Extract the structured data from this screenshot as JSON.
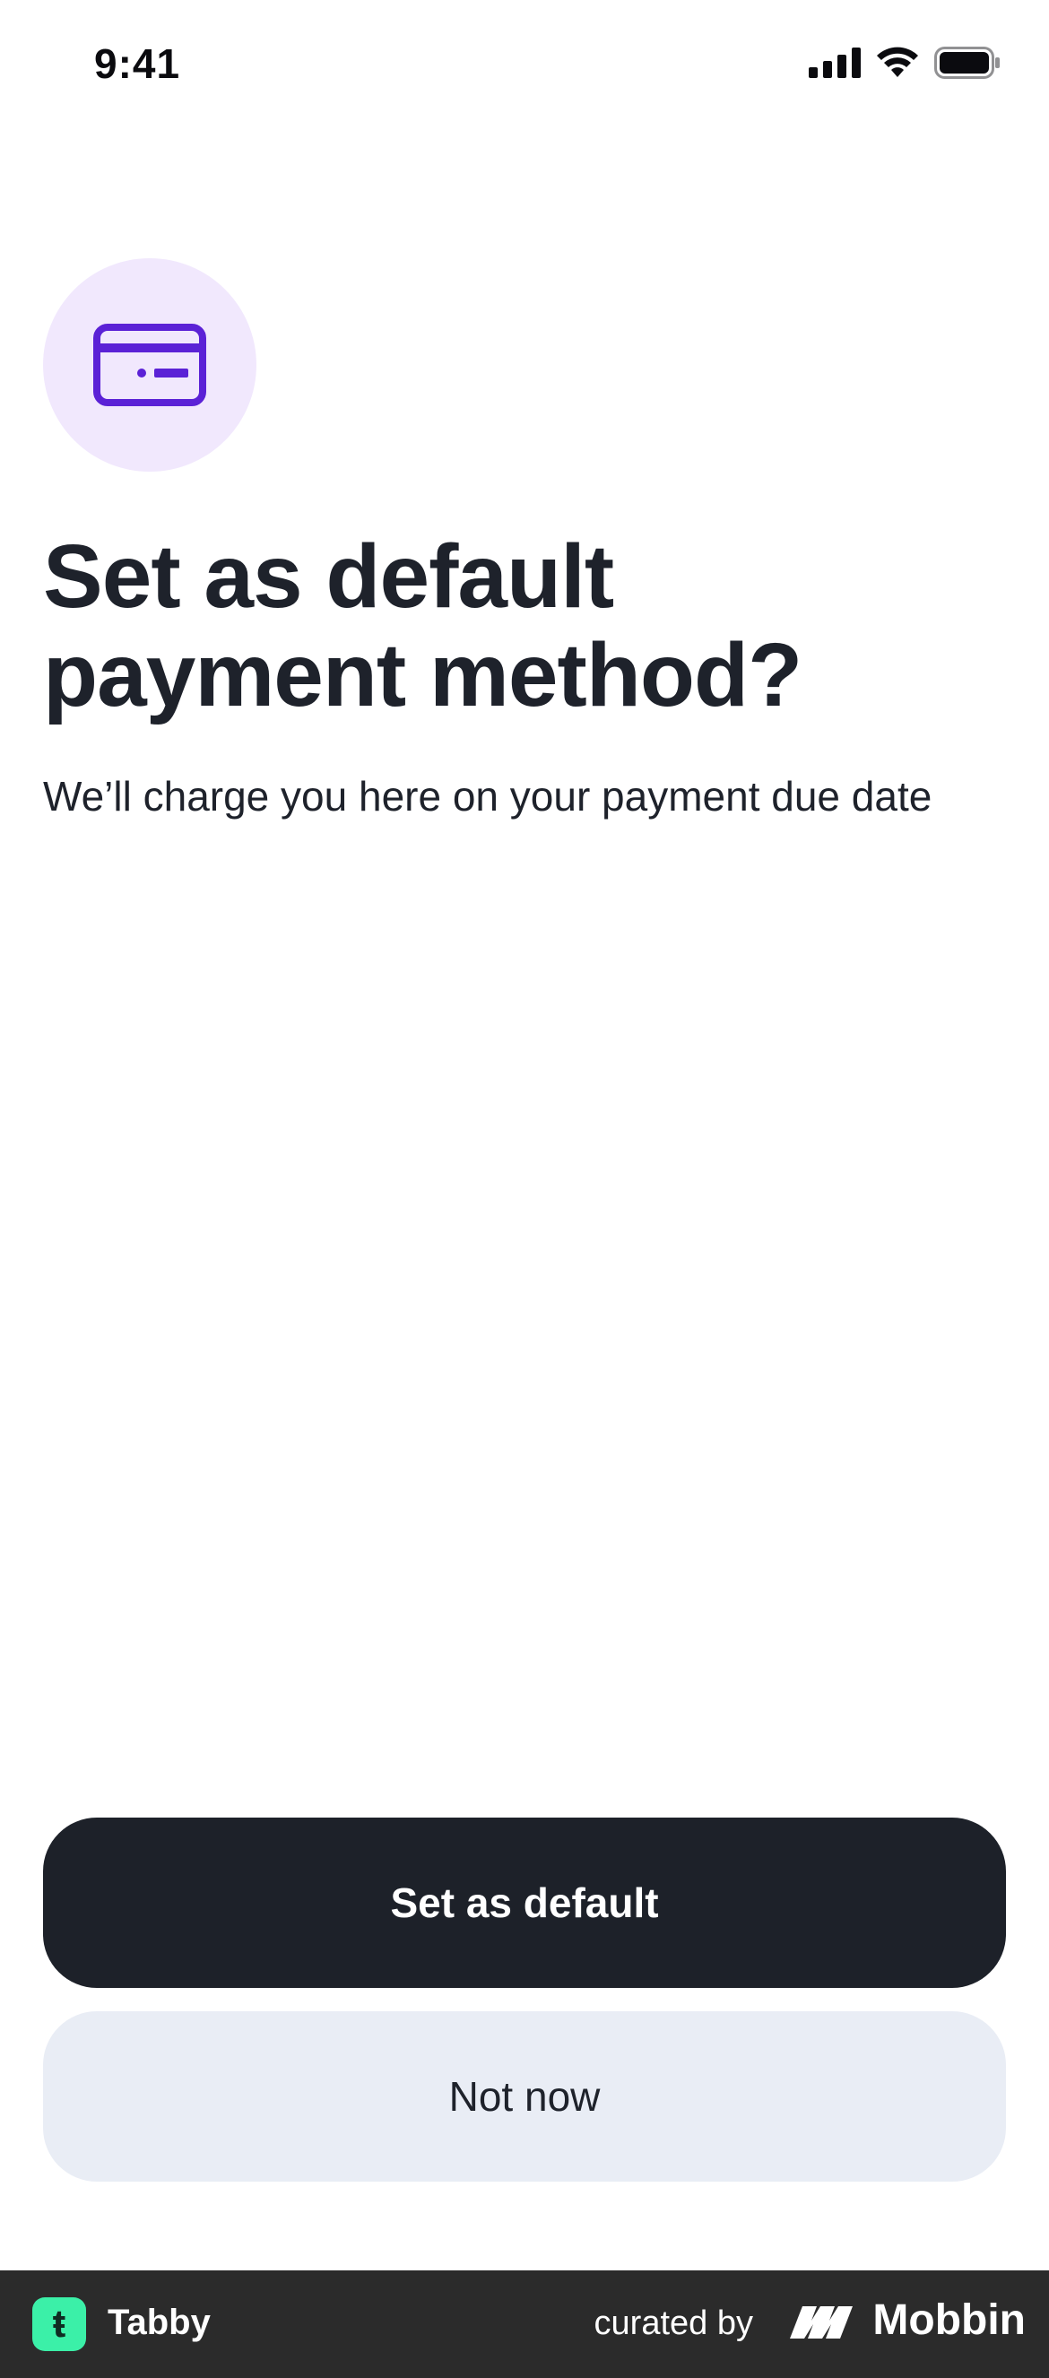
{
  "status_bar": {
    "time": "9:41",
    "icons": [
      "signal-icon",
      "wifi-icon",
      "battery-icon"
    ]
  },
  "hero": {
    "icon": "credit-card-icon",
    "accent_color": "#5b21d6",
    "circle_color": "#f1e8fd"
  },
  "content": {
    "title_line1": "Set as default",
    "title_line2": "payment method?",
    "subtitle": "We’ll charge you here on your payment due date"
  },
  "actions": {
    "primary_label": "Set as default",
    "secondary_label": "Not now"
  },
  "footer": {
    "app_name": "Tabby",
    "app_logo_letter": "ŧ",
    "curated_by": "curated by",
    "brand": "Mobbin"
  }
}
